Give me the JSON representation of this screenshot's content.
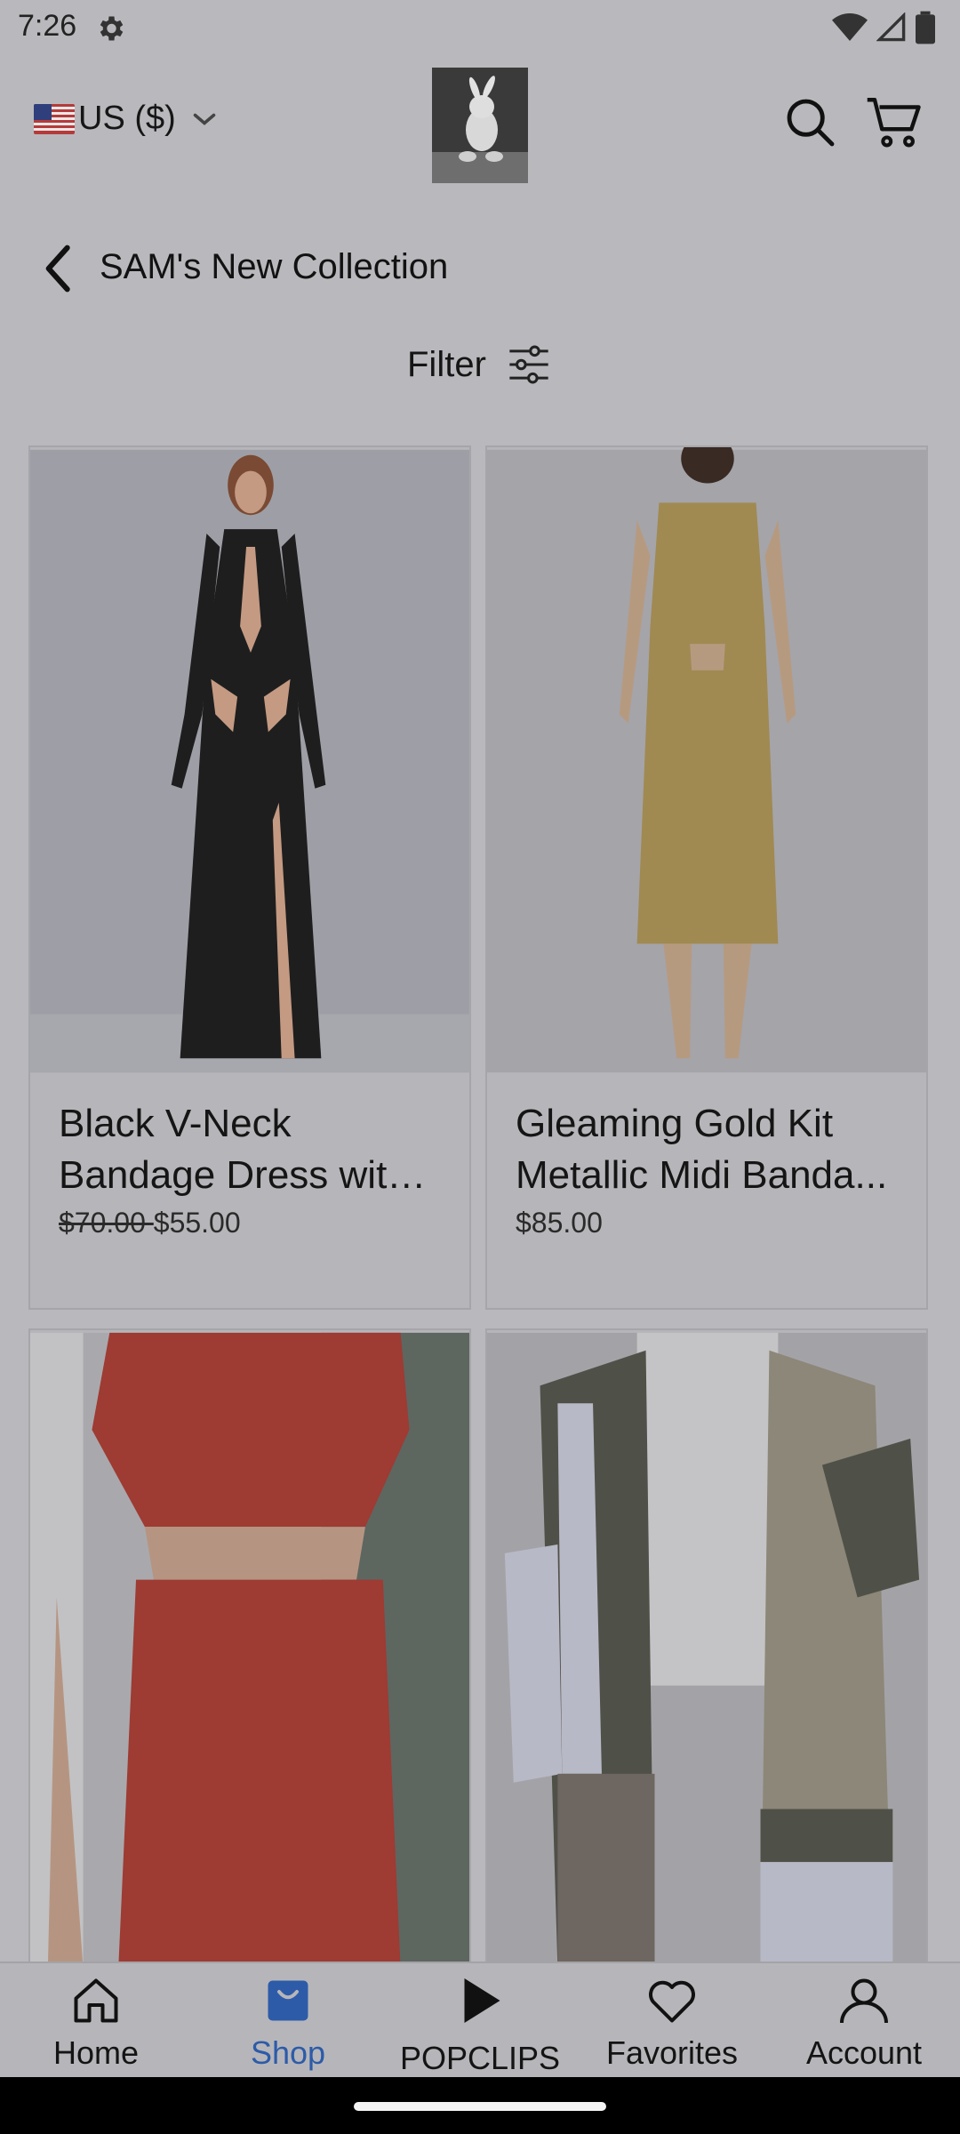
{
  "status_bar": {
    "time": "7:26"
  },
  "header": {
    "currency_label": "US ($)"
  },
  "page": {
    "title": "SAM's New Collection",
    "filter_label": "Filter"
  },
  "products": [
    {
      "name": "Black V-Neck Bandage Dress with ..",
      "price_old": "$70.00 ",
      "price": "$55.00"
    },
    {
      "name": "Gleaming Gold Kit Metallic Midi Banda...",
      "price_old": "",
      "price": "$85.00"
    },
    {
      "name": "",
      "price_old": "",
      "price": ""
    },
    {
      "name": "",
      "price_old": "",
      "price": ""
    }
  ],
  "bottom_nav": {
    "items": [
      {
        "label": "Home",
        "icon": "home-icon"
      },
      {
        "label": "Shop",
        "icon": "shop-bag-icon",
        "active": true
      },
      {
        "label": "POPCLIPS",
        "icon": "play-icon"
      },
      {
        "label": "Favorites",
        "icon": "heart-icon"
      },
      {
        "label": "Account",
        "icon": "account-icon"
      }
    ]
  },
  "colors": {
    "overlay_bg": "#b9b9bd",
    "active_nav": "#2d5ba8"
  }
}
